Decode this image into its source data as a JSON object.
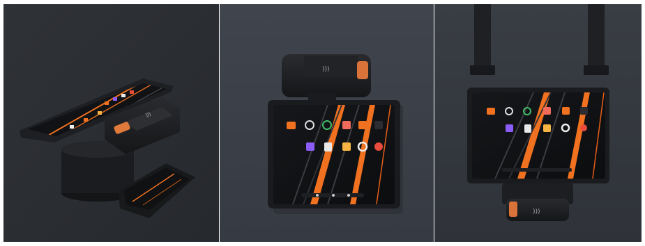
{
  "panels": [
    {
      "name": "pos-desktop-with-customer-display"
    },
    {
      "name": "tablet-with-top-card-reader"
    },
    {
      "name": "tablet-on-lanyard-with-bottom-card-reader"
    }
  ],
  "colors": {
    "background_left": "#2b2e33",
    "background_middle": "#3b3f48",
    "background_right": "#34383f",
    "device_body": "#1c1d20",
    "screen": "#0f1012",
    "accent_orange": "#f0711f",
    "frame": "#ffffff"
  },
  "icon_names": [
    "mail-icon",
    "settings-icon",
    "browser-icon",
    "gallery-icon",
    "shop-icon",
    "calendar-icon",
    "video-icon",
    "camera-icon",
    "notes-icon",
    "record-icon",
    "clock-icon"
  ]
}
